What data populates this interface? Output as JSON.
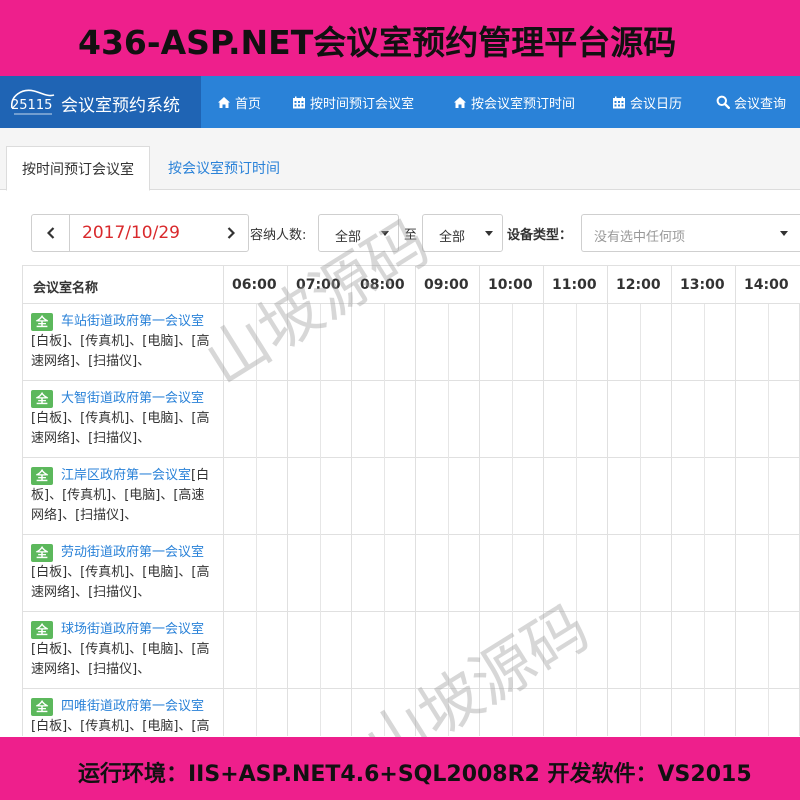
{
  "banner": {
    "title": "436-ASP.NET会议室预约管理平台源码",
    "footer": "运行环境：IIS+ASP.NET4.6+SQL2008R2  开发软件：VS2015"
  },
  "brand": {
    "logo_text": "25115",
    "title": "会议室预约系统"
  },
  "nav": [
    {
      "icon": "home-icon",
      "label": "首页"
    },
    {
      "icon": "calendar-icon",
      "label": "按时间预订会议室"
    },
    {
      "icon": "home-icon",
      "label": "按会议室预订时间"
    },
    {
      "icon": "calendar-icon",
      "label": "会议日历"
    },
    {
      "icon": "search-icon",
      "label": "会议查询"
    }
  ],
  "tabs": [
    {
      "label": "按时间预订会议室",
      "active": true
    },
    {
      "label": "按会议室预订时间",
      "active": false
    }
  ],
  "filters": {
    "date": "2017/10/29",
    "capacity_label": "容纳人数:",
    "capacity_from": "全部",
    "range_sep": "至",
    "capacity_to": "全部",
    "equipment_label": "设备类型：",
    "equipment_placeholder": "没有选中任何项"
  },
  "grid": {
    "name_header": "会议室名称",
    "hours": [
      "06:00",
      "07:00",
      "08:00",
      "09:00",
      "10:00",
      "11:00",
      "12:00",
      "13:00",
      "14:00"
    ],
    "rooms": [
      {
        "badge": "全",
        "name": "车站街道政府第一会议室",
        "equipment": "[白板]、[传真机]、[电脑]、[高速网络]、[扫描仪]、"
      },
      {
        "badge": "全",
        "name": "大智街道政府第一会议室",
        "equipment": "[白板]、[传真机]、[电脑]、[高速网络]、[扫描仪]、"
      },
      {
        "badge": "全",
        "name": "江岸区政府第一会议室",
        "equipment": "[白板]、[传真机]、[电脑]、[高速网络]、[扫描仪]、"
      },
      {
        "badge": "全",
        "name": "劳动街道政府第一会议室",
        "equipment": "[白板]、[传真机]、[电脑]、[高速网络]、[扫描仪]、"
      },
      {
        "badge": "全",
        "name": "球场街道政府第一会议室",
        "equipment": "[白板]、[传真机]、[电脑]、[高速网络]、[扫描仪]、"
      },
      {
        "badge": "全",
        "name": "四唯街道政府第一会议室",
        "equipment": "[白板]、[传真机]、[电脑]、[高速网络]、[扫描仪]、"
      }
    ]
  },
  "watermark": "山坡源码",
  "colors": {
    "banner": "#ee1f8c",
    "navbar": "#2a82d8",
    "brand": "#1f64b4",
    "badge": "#5cb85c",
    "date": "#d9292c"
  }
}
